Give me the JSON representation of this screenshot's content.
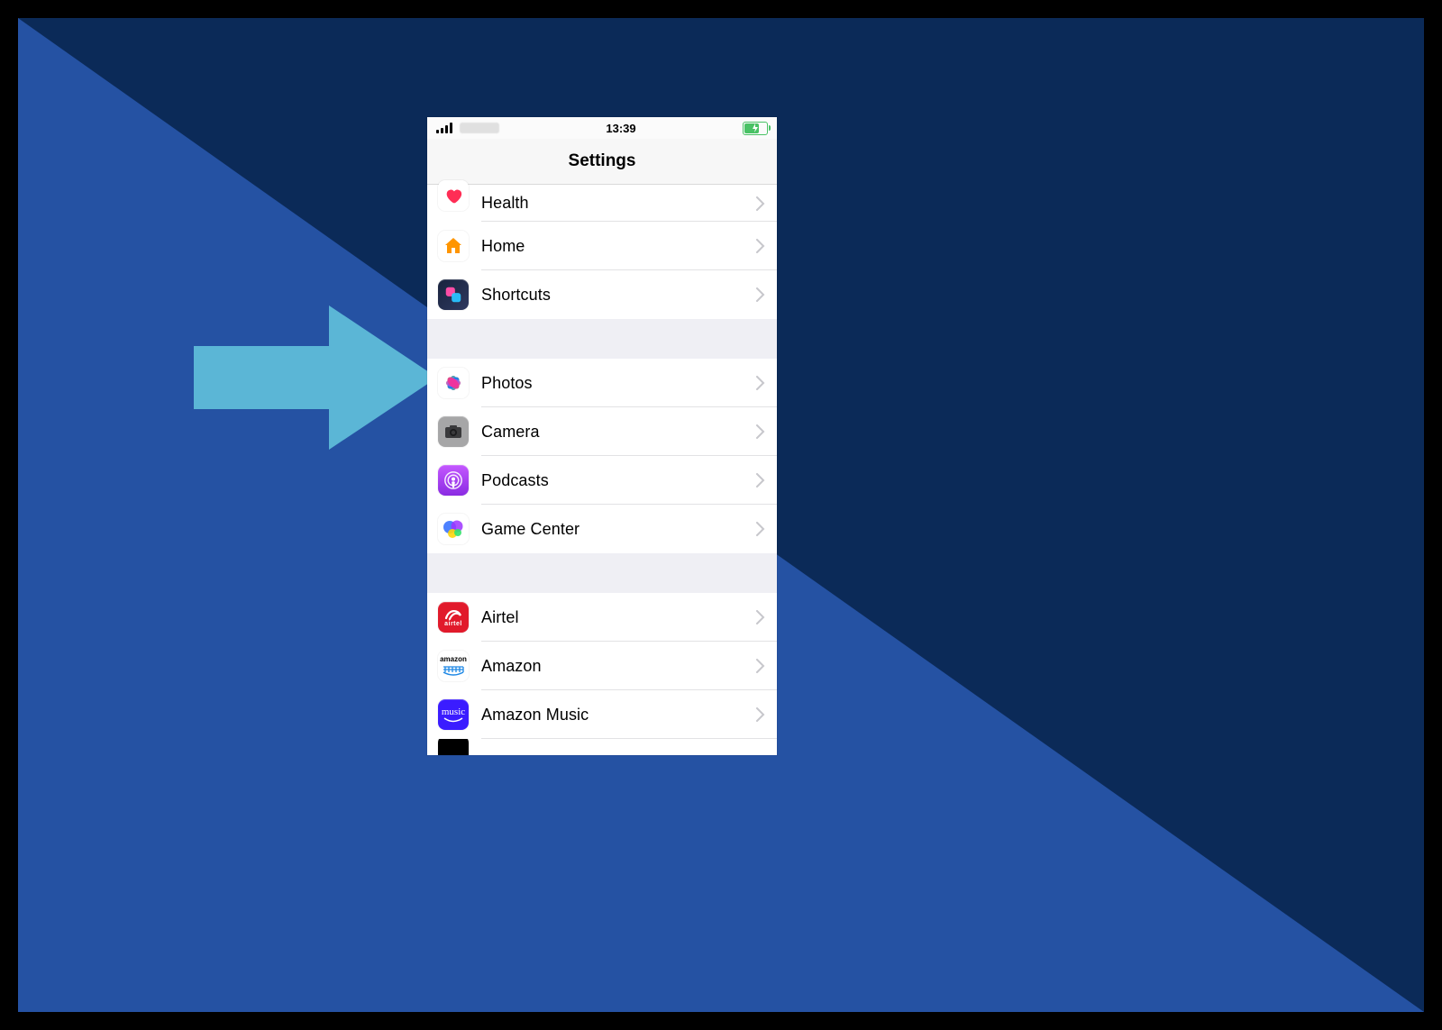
{
  "status": {
    "time": "13:39"
  },
  "nav": {
    "title": "Settings"
  },
  "groups": [
    {
      "items": [
        {
          "key": "health",
          "label": "Health"
        },
        {
          "key": "home",
          "label": "Home"
        },
        {
          "key": "shortcuts",
          "label": "Shortcuts"
        }
      ]
    },
    {
      "items": [
        {
          "key": "photos",
          "label": "Photos"
        },
        {
          "key": "camera",
          "label": "Camera"
        },
        {
          "key": "podcasts",
          "label": "Podcasts"
        },
        {
          "key": "gamecenter",
          "label": "Game Center"
        }
      ]
    },
    {
      "items": [
        {
          "key": "airtel",
          "label": "Airtel"
        },
        {
          "key": "amazon",
          "label": "Amazon"
        },
        {
          "key": "amazonmusic",
          "label": "Amazon Music"
        }
      ]
    }
  ],
  "annotation": {
    "arrow_target": "photos"
  },
  "colors": {
    "stage_bg_dark": "#0b2a58",
    "stage_bg_light": "#2552a3",
    "arrow": "#5bb6d6"
  }
}
